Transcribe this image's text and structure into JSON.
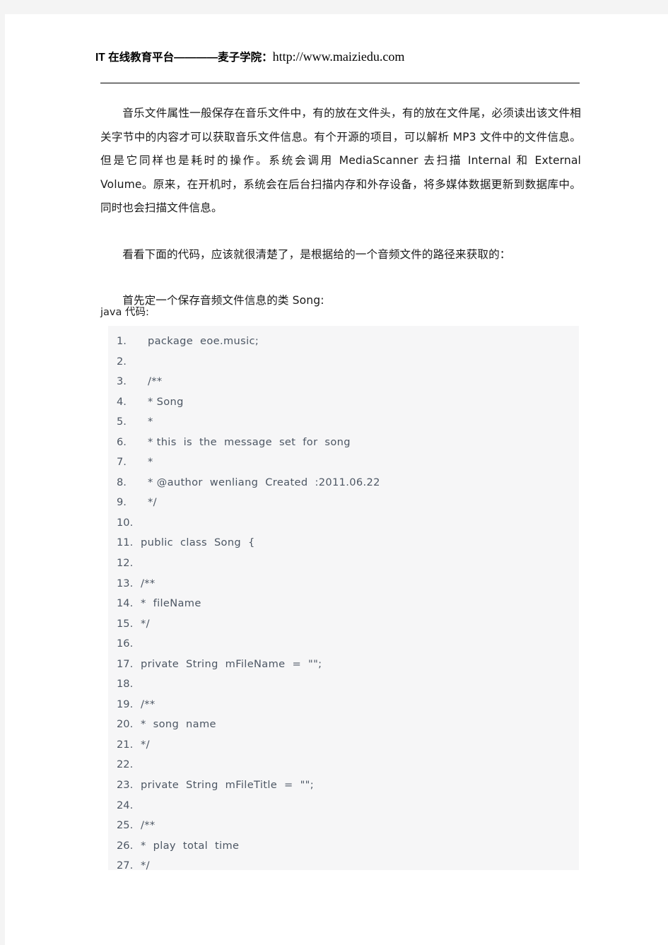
{
  "header": {
    "label": "IT 在线教育平台————麦子学院：",
    "url": "http://www.maiziedu.com"
  },
  "body": {
    "paragraphs": [
      "音乐文件属性一般保存在音乐文件中，有的放在文件头，有的放在文件尾，必须读出该文件相关字节中的内容才可以获取音乐文件信息。有个开源的项目，可以解析 MP3 文件中的文件信息。但是它同样也是耗时的操作。系统会调用 MediaScanner 去扫描 Internal 和 External Volume。原来，在开机时，系统会在后台扫描内存和外存设备，将多媒体数据更新到数据库中。同时也会扫描文件信息。",
      "看看下面的代码，应该就很清楚了，是根据给的一个音频文件的路径来获取的：",
      "首先定一个保存音频文件信息的类 Song:"
    ]
  },
  "code": {
    "label": "java 代码:",
    "language": "java",
    "lines": [
      {
        "n": "1.",
        "text": "package  eoe.music;"
      },
      {
        "n": "2.",
        "text": ""
      },
      {
        "n": "3.",
        "text": "/**"
      },
      {
        "n": "4.",
        "text": "* Song"
      },
      {
        "n": "5.",
        "text": "*"
      },
      {
        "n": "6.",
        "text": "* this  is  the  message  set  for  song"
      },
      {
        "n": "7.",
        "text": "*"
      },
      {
        "n": "8.",
        "text": "* @author  wenliang  Created  :2011.06.22"
      },
      {
        "n": "9.",
        "text": "*/"
      },
      {
        "n": "10.",
        "text": ""
      },
      {
        "n": "11.",
        "text": "public  class  Song  {"
      },
      {
        "n": "12.",
        "text": ""
      },
      {
        "n": "13.",
        "text": "/**"
      },
      {
        "n": "14.",
        "text": "*  fileName"
      },
      {
        "n": "15.",
        "text": "*/"
      },
      {
        "n": "16.",
        "text": ""
      },
      {
        "n": "17.",
        "text": "private  String  mFileName  =  \"\";"
      },
      {
        "n": "18.",
        "text": ""
      },
      {
        "n": "19.",
        "text": "/**"
      },
      {
        "n": "20.",
        "text": "*  song  name"
      },
      {
        "n": "21.",
        "text": "*/"
      },
      {
        "n": "22.",
        "text": ""
      },
      {
        "n": "23.",
        "text": "private  String  mFileTitle  =  \"\";"
      },
      {
        "n": "24.",
        "text": ""
      },
      {
        "n": "25.",
        "text": "/**"
      },
      {
        "n": "26.",
        "text": "*  play  total  time"
      },
      {
        "n": "27.",
        "text": "*/"
      }
    ]
  },
  "colors": {
    "page_background": "#ffffff",
    "canvas_background": "#f4f4f4",
    "code_background": "#f6f6f7",
    "code_text": "#4c5663",
    "body_text": "#1a1a1a",
    "rule": "#000000"
  }
}
